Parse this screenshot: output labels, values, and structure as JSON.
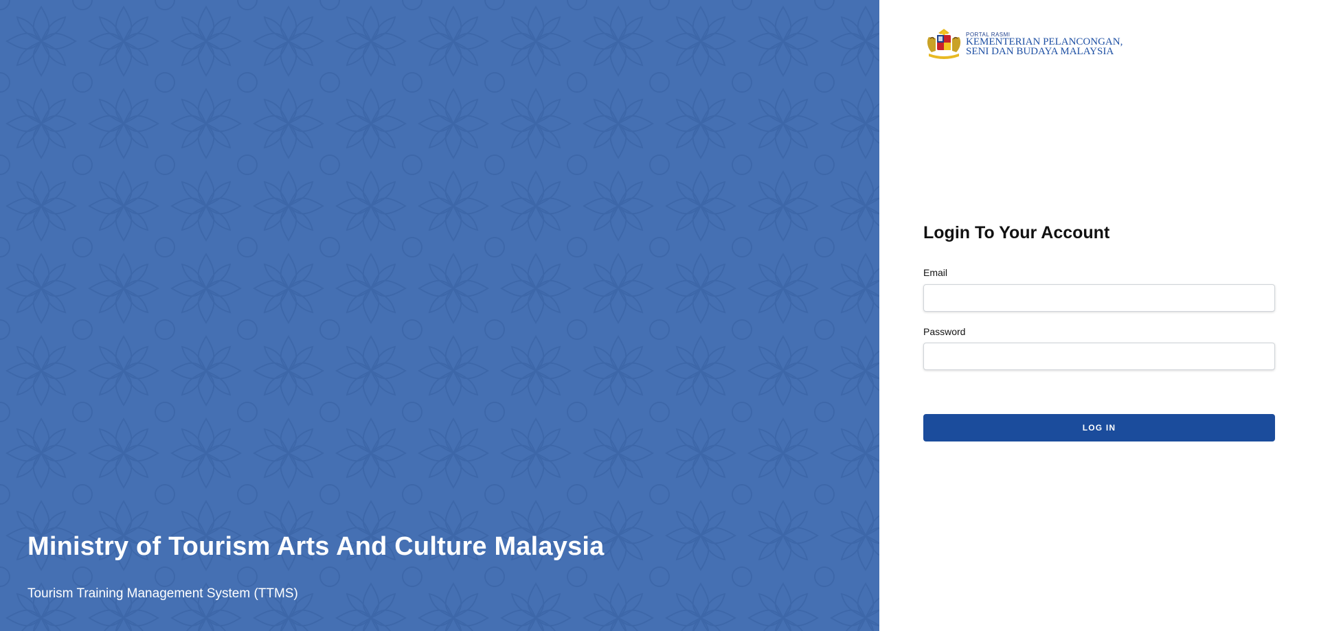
{
  "hero": {
    "title": "Ministry of Tourism Arts And Culture Malaysia",
    "subtitle": "Tourism Training Management System (TTMS)",
    "background_color": "#4570b3"
  },
  "logo": {
    "portal_label": "PORTAL RASMI",
    "line1": "KEMENTERIAN PELANCONGAN,",
    "line2": "SENI DAN BUDAYA MALAYSIA",
    "icon": "malaysia-coat-of-arms-icon"
  },
  "login": {
    "title": "Login To Your Account",
    "email_label": "Email",
    "email_value": "",
    "password_label": "Password",
    "password_value": "",
    "submit_label": "LOG IN",
    "accent_color": "#1b4c9c"
  }
}
